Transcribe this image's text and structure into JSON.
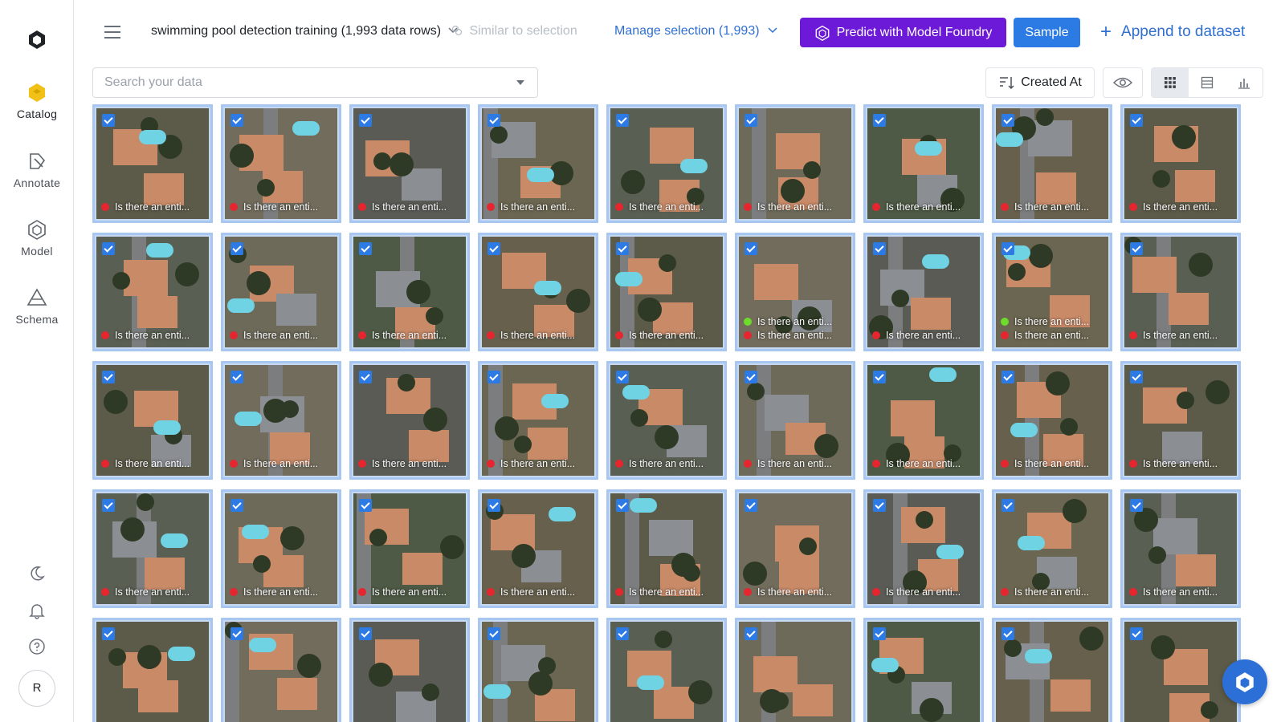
{
  "sidebar": {
    "items": [
      {
        "label": "Catalog",
        "icon": "catalog-icon",
        "active": true
      },
      {
        "label": "Annotate",
        "icon": "annotate-icon",
        "active": false
      },
      {
        "label": "Model",
        "icon": "model-icon",
        "active": false
      },
      {
        "label": "Schema",
        "icon": "schema-icon",
        "active": false
      }
    ],
    "avatar_initial": "R"
  },
  "header": {
    "dataset_title": "swimming pool detection training (1,993 data rows)",
    "similar_label": "Similar to selection",
    "manage_label": "Manage selection (1,993)",
    "predict_label": "Predict with Model Foundry",
    "sample_label": "Sample",
    "append_label": "Append to dataset"
  },
  "toolbar": {
    "search_placeholder": "Search your data",
    "sort_label": "Created At"
  },
  "colors": {
    "accent": "#2c7be5",
    "predict": "#6d19d8",
    "tile_border": "#a8c7f0",
    "dot_red": "#e5262e",
    "dot_green": "#6ddc2a"
  },
  "grid": {
    "label_text": "Is there an enti...",
    "tiles": [
      {
        "labels": [
          "Is there an enti..."
        ],
        "dots": [
          "red"
        ]
      },
      {
        "labels": [
          "Is there an enti..."
        ],
        "dots": [
          "red"
        ]
      },
      {
        "labels": [
          "Is there an enti..."
        ],
        "dots": [
          "red"
        ]
      },
      {
        "labels": [
          "Is there an enti..."
        ],
        "dots": [
          "red"
        ]
      },
      {
        "labels": [
          "Is there an enti..."
        ],
        "dots": [
          "red"
        ]
      },
      {
        "labels": [
          "Is there an enti..."
        ],
        "dots": [
          "red"
        ]
      },
      {
        "labels": [
          "Is there an enti..."
        ],
        "dots": [
          "red"
        ]
      },
      {
        "labels": [
          "Is there an enti..."
        ],
        "dots": [
          "red"
        ]
      },
      {
        "labels": [
          "Is there an enti..."
        ],
        "dots": [
          "red"
        ]
      },
      {
        "labels": [
          "Is there an enti..."
        ],
        "dots": [
          "red"
        ]
      },
      {
        "labels": [
          "Is there an enti..."
        ],
        "dots": [
          "red"
        ]
      },
      {
        "labels": [
          "Is there an enti..."
        ],
        "dots": [
          "red"
        ]
      },
      {
        "labels": [
          "Is there an enti..."
        ],
        "dots": [
          "red"
        ]
      },
      {
        "labels": [
          "Is there an enti..."
        ],
        "dots": [
          "red"
        ]
      },
      {
        "labels": [
          "Is there an enti...",
          "Is there an enti..."
        ],
        "dots": [
          "green",
          "red"
        ]
      },
      {
        "labels": [
          "Is there an enti..."
        ],
        "dots": [
          "red"
        ]
      },
      {
        "labels": [
          "Is there an enti...",
          "Is there an enti..."
        ],
        "dots": [
          "green",
          "red"
        ]
      },
      {
        "labels": [
          "Is there an enti..."
        ],
        "dots": [
          "red"
        ]
      },
      {
        "labels": [
          "Is there an enti..."
        ],
        "dots": [
          "red"
        ]
      },
      {
        "labels": [
          "Is there an enti..."
        ],
        "dots": [
          "red"
        ]
      },
      {
        "labels": [
          "Is there an enti..."
        ],
        "dots": [
          "red"
        ]
      },
      {
        "labels": [
          "Is there an enti..."
        ],
        "dots": [
          "red"
        ]
      },
      {
        "labels": [
          "Is there an enti..."
        ],
        "dots": [
          "red"
        ]
      },
      {
        "labels": [
          "Is there an enti..."
        ],
        "dots": [
          "red"
        ]
      },
      {
        "labels": [
          "Is there an enti..."
        ],
        "dots": [
          "red"
        ]
      },
      {
        "labels": [
          "Is there an enti..."
        ],
        "dots": [
          "red"
        ]
      },
      {
        "labels": [
          "Is there an enti..."
        ],
        "dots": [
          "red"
        ]
      },
      {
        "labels": [
          "Is there an enti..."
        ],
        "dots": [
          "red"
        ]
      },
      {
        "labels": [
          "Is there an enti..."
        ],
        "dots": [
          "red"
        ]
      },
      {
        "labels": [
          "Is there an enti..."
        ],
        "dots": [
          "red"
        ]
      },
      {
        "labels": [
          "Is there an enti..."
        ],
        "dots": [
          "red"
        ]
      },
      {
        "labels": [
          "Is there an enti..."
        ],
        "dots": [
          "red"
        ]
      },
      {
        "labels": [
          "Is there an enti..."
        ],
        "dots": [
          "red"
        ]
      },
      {
        "labels": [
          "Is there an enti..."
        ],
        "dots": [
          "red"
        ]
      },
      {
        "labels": [
          "Is there an enti..."
        ],
        "dots": [
          "red"
        ]
      },
      {
        "labels": [
          "Is there an enti..."
        ],
        "dots": [
          "red"
        ]
      },
      {
        "labels": [],
        "dots": []
      },
      {
        "labels": [],
        "dots": []
      },
      {
        "labels": [],
        "dots": []
      },
      {
        "labels": [],
        "dots": []
      },
      {
        "labels": [],
        "dots": []
      },
      {
        "labels": [],
        "dots": []
      },
      {
        "labels": [],
        "dots": []
      },
      {
        "labels": [],
        "dots": []
      },
      {
        "labels": [],
        "dots": []
      }
    ]
  }
}
